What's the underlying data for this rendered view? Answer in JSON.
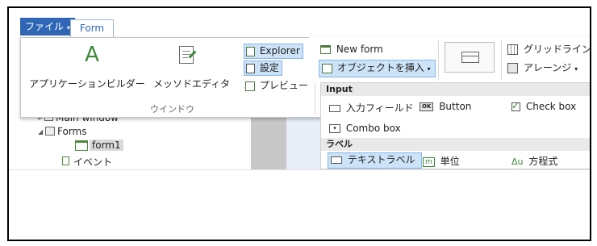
{
  "tabs": {
    "file_label": "ファイル",
    "form_label": "Form"
  },
  "ribbon": {
    "app_builder_label": "アプリケーションビルダー",
    "method_editor_label": "メッソドエディタ",
    "explorer_label": "Explorer",
    "settings_label": "設定",
    "preview_label": "プレビュー",
    "window_group_label": "ウインドウ",
    "new_form_label": "New form",
    "insert_object_label": "オブジェクトを挿入",
    "grid_layout_label": "グリッドライン",
    "arrange_label": "アレーンジ",
    "app_builder_icon_glyph": "A"
  },
  "tree": {
    "main_window_label": "Main window",
    "forms_label": "Forms",
    "form1_label": "form1",
    "events_label": "イベント"
  },
  "dropdown": {
    "input_header": "Input",
    "input_field_label": "入力フィールド",
    "button_label": "Button",
    "checkbox_label": "Check box",
    "combobox_label": "Combo box",
    "label_header": "ラベル",
    "text_label_label": "テキストラベル",
    "unit_label": "単位",
    "equation_label": "方程式",
    "button_icon_text": "OK",
    "unit_icon_text": "m",
    "equation_icon_text": "Δu"
  },
  "colors": {
    "accent": "#2f67b6",
    "selection": "#cde3f7",
    "check": "#3a8a3a"
  }
}
